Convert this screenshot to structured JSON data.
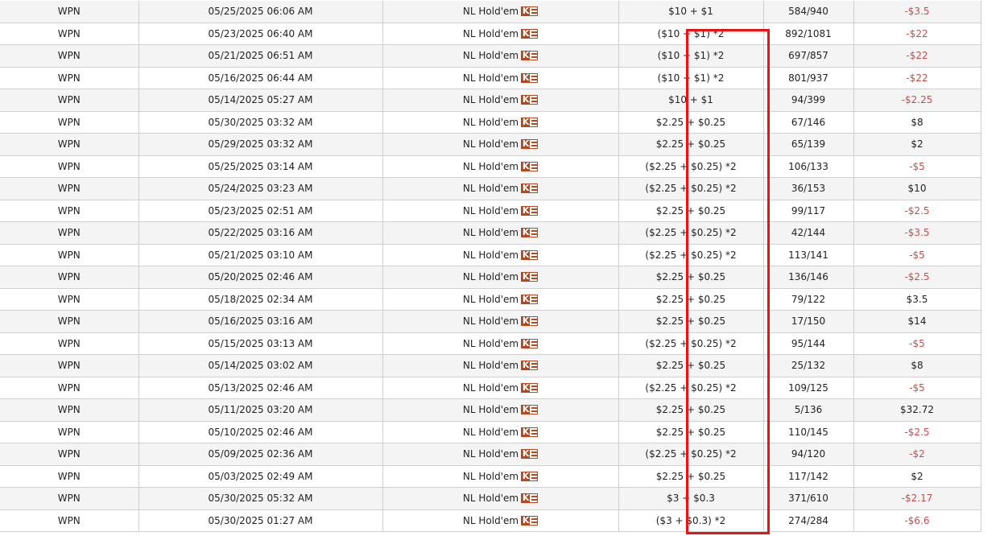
{
  "colors": {
    "negative": "#c0504d",
    "row_alt": "#f4f4f4",
    "highlight_border": "#ee1111",
    "ko_badge": "#b5481e"
  },
  "icons": {
    "game_badge": "ko-badge-icon"
  },
  "rows": [
    {
      "network": "WPN",
      "date": "05/25/2025 06:06 AM",
      "game": "NL Hold'em",
      "buyin": "$10 + $1",
      "position": "584/940",
      "result": "-$3.5"
    },
    {
      "network": "WPN",
      "date": "05/23/2025 06:40 AM",
      "game": "NL Hold'em",
      "buyin": "($10 + $1) *2",
      "position": "892/1081",
      "result": "-$22"
    },
    {
      "network": "WPN",
      "date": "05/21/2025 06:51 AM",
      "game": "NL Hold'em",
      "buyin": "($10 + $1) *2",
      "position": "697/857",
      "result": "-$22"
    },
    {
      "network": "WPN",
      "date": "05/16/2025 06:44 AM",
      "game": "NL Hold'em",
      "buyin": "($10 + $1) *2",
      "position": "801/937",
      "result": "-$22"
    },
    {
      "network": "WPN",
      "date": "05/14/2025 05:27 AM",
      "game": "NL Hold'em",
      "buyin": "$10 + $1",
      "position": "94/399",
      "result": "-$2.25"
    },
    {
      "network": "WPN",
      "date": "05/30/2025 03:32 AM",
      "game": "NL Hold'em",
      "buyin": "$2.25 + $0.25",
      "position": "67/146",
      "result": "$8"
    },
    {
      "network": "WPN",
      "date": "05/29/2025 03:32 AM",
      "game": "NL Hold'em",
      "buyin": "$2.25 + $0.25",
      "position": "65/139",
      "result": "$2"
    },
    {
      "network": "WPN",
      "date": "05/25/2025 03:14 AM",
      "game": "NL Hold'em",
      "buyin": "($2.25 + $0.25) *2",
      "position": "106/133",
      "result": "-$5"
    },
    {
      "network": "WPN",
      "date": "05/24/2025 03:23 AM",
      "game": "NL Hold'em",
      "buyin": "($2.25 + $0.25) *2",
      "position": "36/153",
      "result": "$10"
    },
    {
      "network": "WPN",
      "date": "05/23/2025 02:51 AM",
      "game": "NL Hold'em",
      "buyin": "$2.25 + $0.25",
      "position": "99/117",
      "result": "-$2.5"
    },
    {
      "network": "WPN",
      "date": "05/22/2025 03:16 AM",
      "game": "NL Hold'em",
      "buyin": "($2.25 + $0.25) *2",
      "position": "42/144",
      "result": "-$3.5"
    },
    {
      "network": "WPN",
      "date": "05/21/2025 03:10 AM",
      "game": "NL Hold'em",
      "buyin": "($2.25 + $0.25) *2",
      "position": "113/141",
      "result": "-$5"
    },
    {
      "network": "WPN",
      "date": "05/20/2025 02:46 AM",
      "game": "NL Hold'em",
      "buyin": "$2.25 + $0.25",
      "position": "136/146",
      "result": "-$2.5"
    },
    {
      "network": "WPN",
      "date": "05/18/2025 02:34 AM",
      "game": "NL Hold'em",
      "buyin": "$2.25 + $0.25",
      "position": "79/122",
      "result": "$3.5"
    },
    {
      "network": "WPN",
      "date": "05/16/2025 03:16 AM",
      "game": "NL Hold'em",
      "buyin": "$2.25 + $0.25",
      "position": "17/150",
      "result": "$14"
    },
    {
      "network": "WPN",
      "date": "05/15/2025 03:13 AM",
      "game": "NL Hold'em",
      "buyin": "($2.25 + $0.25) *2",
      "position": "95/144",
      "result": "-$5"
    },
    {
      "network": "WPN",
      "date": "05/14/2025 03:02 AM",
      "game": "NL Hold'em",
      "buyin": "$2.25 + $0.25",
      "position": "25/132",
      "result": "$8"
    },
    {
      "network": "WPN",
      "date": "05/13/2025 02:46 AM",
      "game": "NL Hold'em",
      "buyin": "($2.25 + $0.25) *2",
      "position": "109/125",
      "result": "-$5"
    },
    {
      "network": "WPN",
      "date": "05/11/2025 03:20 AM",
      "game": "NL Hold'em",
      "buyin": "$2.25 + $0.25",
      "position": "5/136",
      "result": "$32.72"
    },
    {
      "network": "WPN",
      "date": "05/10/2025 02:46 AM",
      "game": "NL Hold'em",
      "buyin": "$2.25 + $0.25",
      "position": "110/145",
      "result": "-$2.5"
    },
    {
      "network": "WPN",
      "date": "05/09/2025 02:36 AM",
      "game": "NL Hold'em",
      "buyin": "($2.25 + $0.25) *2",
      "position": "94/120",
      "result": "-$2"
    },
    {
      "network": "WPN",
      "date": "05/03/2025 02:49 AM",
      "game": "NL Hold'em",
      "buyin": "$2.25 + $0.25",
      "position": "117/142",
      "result": "$2"
    },
    {
      "network": "WPN",
      "date": "05/30/2025 05:32 AM",
      "game": "NL Hold'em",
      "buyin": "$3 + $0.3",
      "position": "371/610",
      "result": "-$2.17"
    },
    {
      "network": "WPN",
      "date": "05/30/2025 01:27 AM",
      "game": "NL Hold'em",
      "buyin": "($3 + $0.3) *2",
      "position": "274/284",
      "result": "-$6.6"
    }
  ]
}
